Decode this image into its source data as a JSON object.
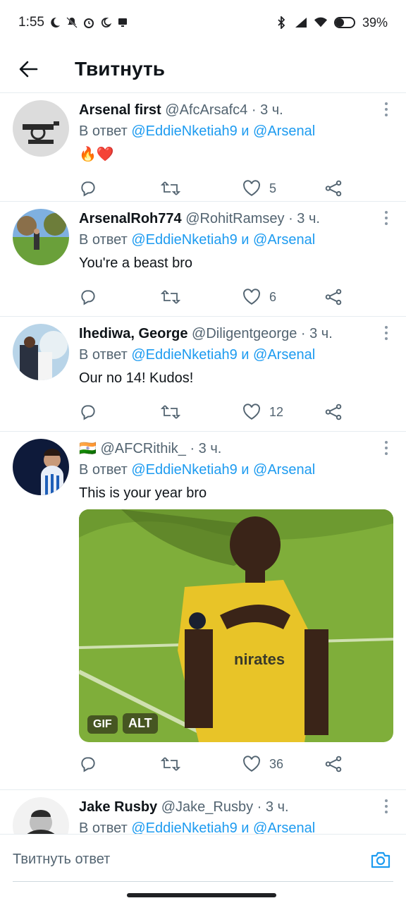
{
  "status_bar": {
    "time": "1:55",
    "battery": "39%"
  },
  "header": {
    "title": "Твитнуть"
  },
  "tweets": [
    {
      "name": "Arsenal first",
      "handle": "@AfcArsafc4",
      "dot_time": "· 3 ч.",
      "reply_prefix": "В ответ",
      "mention1": "@EddieNketiah9",
      "and": "и",
      "mention2": "@Arsenal",
      "text": "🔥❤️",
      "likes": "5"
    },
    {
      "name": "ArsenalRoh774",
      "handle": "@RohitRamsey",
      "dot_time": "· 3 ч.",
      "reply_prefix": "В ответ",
      "mention1": "@EddieNketiah9",
      "and": "и",
      "mention2": "@Arsenal",
      "text": "You're a beast bro",
      "likes": "6"
    },
    {
      "name": "Ihediwa,  George",
      "handle": "@Diligentgeorge",
      "dot_time": "· 3 ч.",
      "reply_prefix": "В ответ",
      "mention1": "@EddieNketiah9",
      "and": "и",
      "mention2": "@Arsenal",
      "text": "Our no 14! Kudos!",
      "likes": "12"
    },
    {
      "name": "🇮🇳",
      "handle": "@AFCRithik_",
      "dot_time": "· 3 ч.",
      "reply_prefix": "В ответ",
      "mention1": "@EddieNketiah9",
      "and": "и",
      "mention2": "@Arsenal",
      "text": "This is your year bro",
      "likes": "36",
      "media_badges": [
        "GIF",
        "ALT"
      ]
    },
    {
      "name": "Jake Rusby",
      "handle": "@Jake_Rusby",
      "dot_time": "· 3 ч.",
      "reply_prefix": "В ответ",
      "mention1": "@EddieNketiah9",
      "and": "и",
      "mention2": "@Arsenal"
    }
  ],
  "composer": {
    "placeholder": "Твитнуть ответ"
  },
  "colors": {
    "accent": "#1d9bf0",
    "secondary_text": "#536471",
    "divider": "#e6ecf0"
  },
  "icons": [
    "arrow-left-icon",
    "reply-icon",
    "retweet-icon",
    "heart-icon",
    "share-icon",
    "more-vertical-icon",
    "camera-icon"
  ]
}
